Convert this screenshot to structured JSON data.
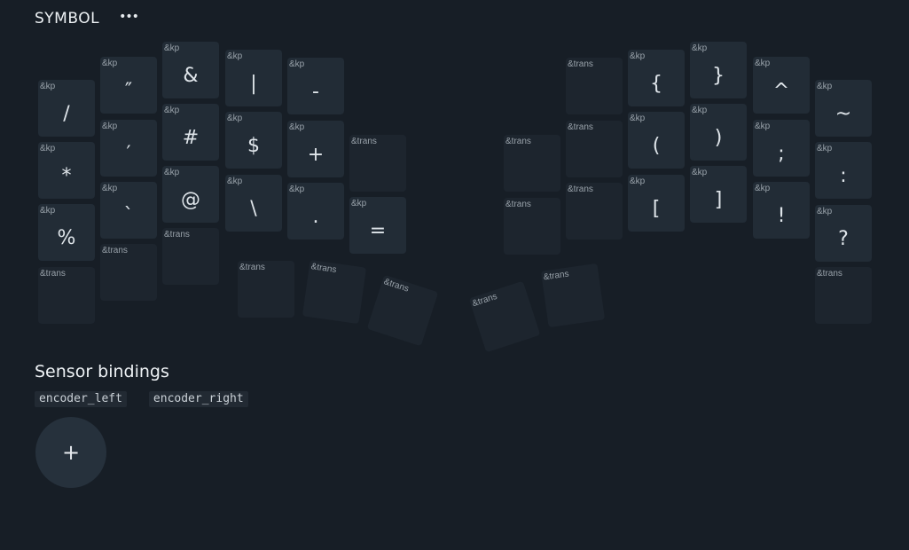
{
  "layer": {
    "title": "SYMBOL",
    "more_label": "•••"
  },
  "keys": [
    {
      "behavior": "&kp",
      "param": "/"
    },
    {
      "behavior": "&kp",
      "param": "″"
    },
    {
      "behavior": "&kp",
      "param": "&"
    },
    {
      "behavior": "&kp",
      "param": "|"
    },
    {
      "behavior": "&kp",
      "param": "-"
    },
    {
      "behavior": "&trans",
      "param": ""
    },
    {
      "behavior": "&kp",
      "param": "{"
    },
    {
      "behavior": "&kp",
      "param": "}"
    },
    {
      "behavior": "&kp",
      "param": "^"
    },
    {
      "behavior": "&kp",
      "param": "~"
    },
    {
      "behavior": "&kp",
      "param": "*"
    },
    {
      "behavior": "&kp",
      "param": "′"
    },
    {
      "behavior": "&kp",
      "param": "#"
    },
    {
      "behavior": "&kp",
      "param": "$"
    },
    {
      "behavior": "&kp",
      "param": "+"
    },
    {
      "behavior": "&trans",
      "param": ""
    },
    {
      "behavior": "&trans",
      "param": ""
    },
    {
      "behavior": "&trans",
      "param": ""
    },
    {
      "behavior": "&kp",
      "param": "("
    },
    {
      "behavior": "&kp",
      "param": ")"
    },
    {
      "behavior": "&kp",
      "param": ";"
    },
    {
      "behavior": "&kp",
      "param": ":"
    },
    {
      "behavior": "&kp",
      "param": "%"
    },
    {
      "behavior": "&kp",
      "param": "`"
    },
    {
      "behavior": "&kp",
      "param": "@"
    },
    {
      "behavior": "&kp",
      "param": "\\"
    },
    {
      "behavior": "&kp",
      "param": "."
    },
    {
      "behavior": "&kp",
      "param": "="
    },
    {
      "behavior": "&trans",
      "param": ""
    },
    {
      "behavior": "&trans",
      "param": ""
    },
    {
      "behavior": "&kp",
      "param": "["
    },
    {
      "behavior": "&kp",
      "param": "]"
    },
    {
      "behavior": "&kp",
      "param": "!"
    },
    {
      "behavior": "&kp",
      "param": "?"
    },
    {
      "behavior": "&trans",
      "param": ""
    },
    {
      "behavior": "&trans",
      "param": ""
    },
    {
      "behavior": "&trans",
      "param": ""
    },
    {
      "behavior": "&trans",
      "param": ""
    },
    {
      "behavior": "&trans",
      "param": ""
    },
    {
      "behavior": "&trans",
      "param": ""
    },
    {
      "behavior": "&trans",
      "param": ""
    },
    {
      "behavior": "&trans",
      "param": ""
    },
    {
      "behavior": "&trans",
      "param": ""
    }
  ],
  "sensors": {
    "title": "Sensor bindings",
    "items": [
      "encoder_left",
      "encoder_right"
    ],
    "add_label": "+"
  }
}
